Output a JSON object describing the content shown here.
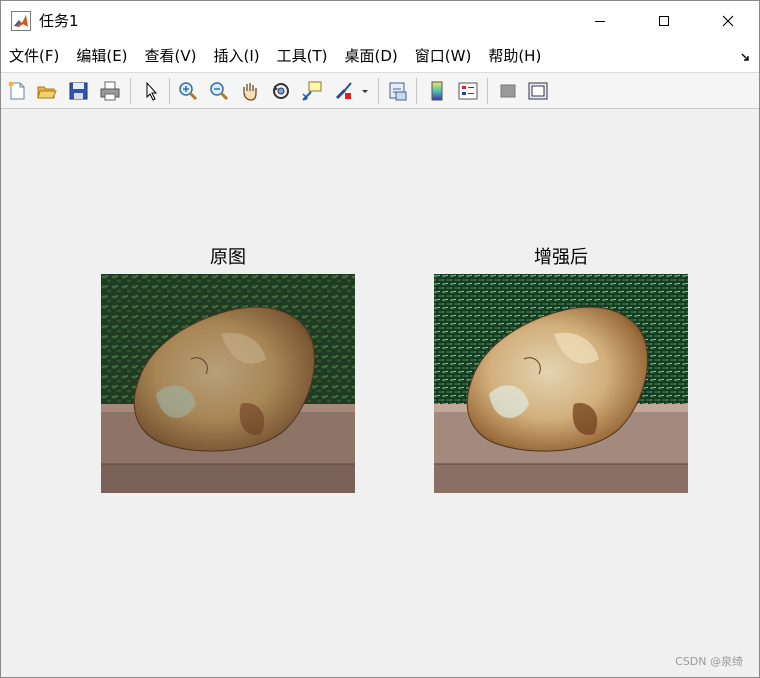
{
  "window": {
    "title": "任务1"
  },
  "menu": [
    {
      "label": "文件(F)"
    },
    {
      "label": "编辑(E)"
    },
    {
      "label": "查看(V)"
    },
    {
      "label": "插入(I)"
    },
    {
      "label": "工具(T)"
    },
    {
      "label": "桌面(D)"
    },
    {
      "label": "窗口(W)"
    },
    {
      "label": "帮助(H)"
    }
  ],
  "toolbar": {
    "icons": [
      "new-figure-icon",
      "open-file-icon",
      "save-icon",
      "print-icon",
      "pointer-icon",
      "zoom-in-icon",
      "zoom-out-icon",
      "pan-icon",
      "rotate-3d-icon",
      "data-cursor-icon",
      "brush-icon",
      "dropdown-arrow-icon",
      "link-plot-icon",
      "colorbar-icon",
      "legend-icon",
      "hide-plot-tools-icon",
      "show-plot-tools-icon"
    ]
  },
  "figure": {
    "left_title": "原图",
    "right_title": "增强后"
  },
  "watermark": "CSDN @泉绮"
}
